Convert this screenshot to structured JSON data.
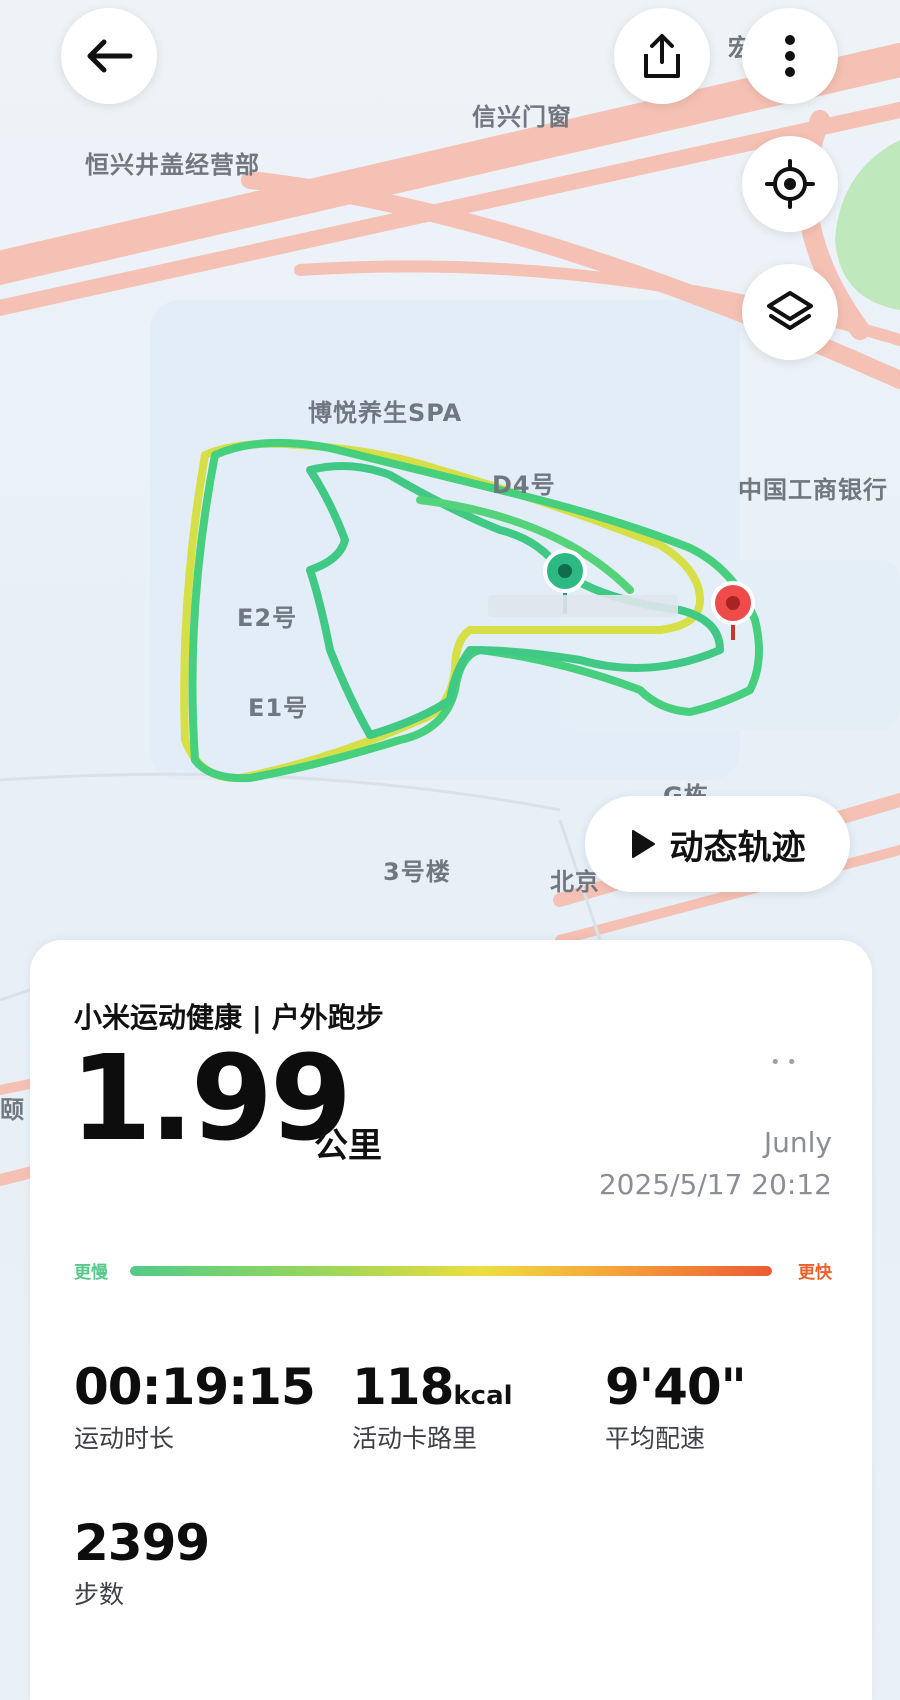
{
  "map": {
    "labels": {
      "poi_1": "恒兴井盖经营部",
      "poi_2": "信兴门窗",
      "poi_3": "博悦养生SPA",
      "poi_4": "D4号",
      "poi_5": "中国工商银行",
      "poi_6": "E2号",
      "poi_7": "E1号",
      "poi_8": "G栋",
      "poi_9": "3号楼",
      "poi_10": "北京",
      "poi_11": "宏",
      "poi_12": "颐"
    }
  },
  "toolbar": {
    "back_icon": "arrow-left-icon",
    "share_icon": "share-icon",
    "more_icon": "more-vertical-icon",
    "locate_icon": "locate-icon",
    "layers_icon": "layers-icon"
  },
  "dynamic_track": {
    "label": "动态轨迹",
    "icon": "play-icon"
  },
  "summary": {
    "title": "小米运动健康 | 户外跑步",
    "distance": "1.99",
    "distance_unit": "公里",
    "owner_badge": "• •",
    "owner": "Junly",
    "datetime": "2025/5/17 20:12",
    "pace_legend": {
      "slow": "更慢",
      "fast": "更快"
    },
    "stats": [
      {
        "value": "00:19:15",
        "unit": "",
        "label": "运动时长"
      },
      {
        "value": "118",
        "unit": "kcal",
        "label": "活动卡路里"
      },
      {
        "value": "9'40\"",
        "unit": "",
        "label": "平均配速"
      },
      {
        "value": "2399",
        "unit": "",
        "label": "步数"
      }
    ]
  },
  "colors": {
    "track_green": "#3ccf7a",
    "track_yellow": "#d9e04a",
    "start_marker": "#2db884",
    "end_marker": "#ef4b4b",
    "road": "#f6c4b8"
  }
}
